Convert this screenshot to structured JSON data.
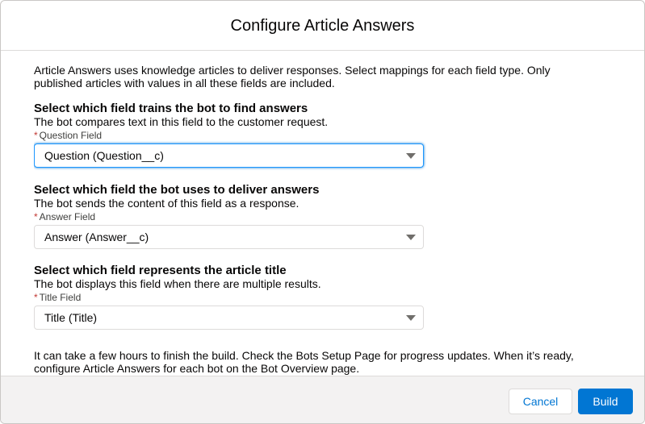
{
  "modal": {
    "title": "Configure Article Answers",
    "intro": "Article Answers uses knowledge articles to deliver responses. Select mappings for each field type. Only published articles with values in all these fields are included.",
    "sections": [
      {
        "title": "Select which field trains the bot to find answers",
        "description": "The bot compares text in this field to the customer request.",
        "required_marker": "*",
        "field_label": "Question Field",
        "selected_value": "Question (Question__c)"
      },
      {
        "title": "Select which field the bot uses to deliver answers",
        "description": "The bot sends the content of this field as a response.",
        "required_marker": "*",
        "field_label": "Answer Field",
        "selected_value": "Answer (Answer__c)"
      },
      {
        "title": "Select which field represents the article title",
        "description": "The bot displays this field when there are multiple results.",
        "required_marker": "*",
        "field_label": "Title Field",
        "selected_value": "Title (Title)"
      }
    ],
    "note": "It can take a few hours to finish the build. Check the Bots Setup Page for progress updates. When it’s ready, configure Article Answers for each bot on the Bot Overview page.",
    "footer": {
      "cancel_label": "Cancel",
      "build_label": "Build"
    }
  },
  "colors": {
    "brand": "#0176d3",
    "required": "#c23934",
    "focus_border": "#1b96ff",
    "footer_bg": "#f3f2f2"
  }
}
